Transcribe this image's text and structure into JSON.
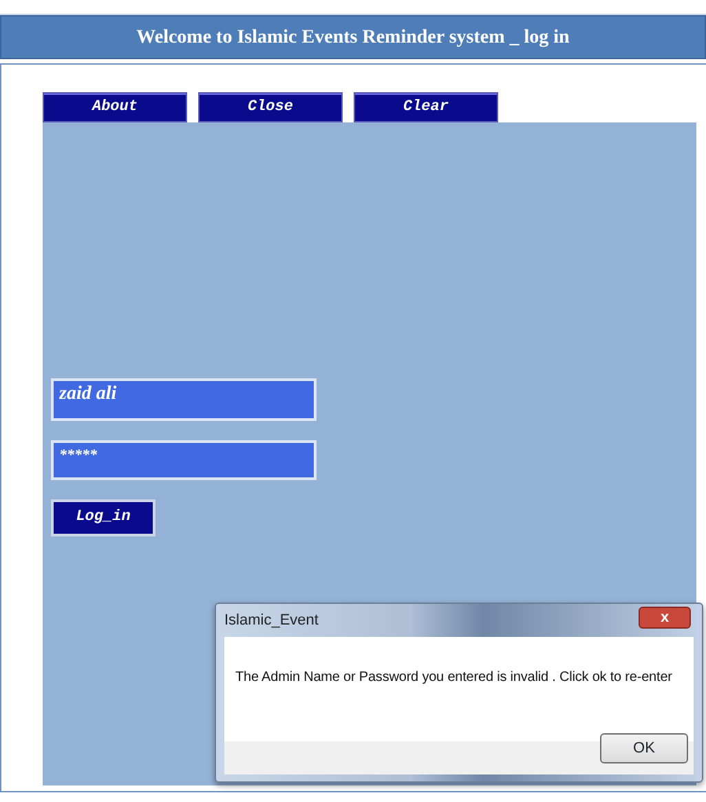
{
  "window": {
    "title": "Welcome to Islamic Events Reminder system _ log in"
  },
  "toolbar_buttons": [
    "About",
    "Close",
    "Clear"
  ],
  "login": {
    "name_value": "zaid ali",
    "password_value": "*****",
    "button": "Log_in"
  },
  "dialog": {
    "title": "Islamic_Event",
    "close": "x",
    "message": "The Admin Name or Password you entered is invalid . Click ok to re-enter",
    "button": "OK"
  }
}
